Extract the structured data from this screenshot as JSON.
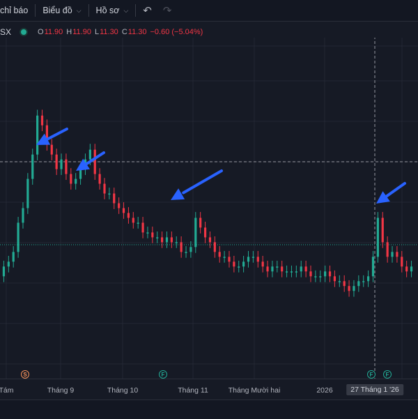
{
  "toolbar": {
    "indicators_label": "chỉ báo",
    "chart_label": "Biểu đồ",
    "profile_label": "Hồ sơ",
    "undo_icon": "undo-icon",
    "redo_icon": "redo-icon"
  },
  "legend": {
    "symbol": "SX",
    "open_label": "O",
    "open": "11.90",
    "high_label": "H",
    "high": "11.90",
    "low_label": "L",
    "low": "11.30",
    "close_label": "C",
    "close": "11.30",
    "change": "−0.60 (−5.04%)"
  },
  "colors": {
    "up": "#22ab94",
    "down": "#f23645",
    "annotation": "#2962ff",
    "background": "#161a25"
  },
  "events": [
    {
      "letter": "S"
    },
    {
      "letter": "F"
    },
    {
      "letter": "F"
    },
    {
      "letter": "F"
    }
  ],
  "x_axis": {
    "labels": [
      "Tám",
      "Tháng 9",
      "Tháng 10",
      "Tháng 11",
      "Tháng Mười hai",
      "2026"
    ],
    "crosshair_label": "27 Tháng 1 '26"
  },
  "chart_data": {
    "type": "candlestick",
    "x_start": "Aug 2025",
    "x_end": "Feb 2026",
    "y_levels": {
      "dashed_reference": 1,
      "dotted_last_price": 1
    },
    "close_values": [
      11.3,
      11.4,
      11.6,
      12.2,
      12.5,
      13.1,
      13.6,
      14.4,
      14.2,
      13.8,
      13.6,
      13.3,
      13.5,
      13.2,
      13.0,
      13.1,
      13.3,
      13.5,
      13.7,
      13.2,
      13.0,
      12.8,
      12.8,
      12.6,
      12.5,
      12.4,
      12.3,
      12.2,
      12.2,
      12.0,
      12.0,
      11.9,
      11.9,
      11.8,
      11.9,
      11.8,
      11.8,
      11.6,
      11.6,
      11.7,
      12.3,
      12.1,
      11.9,
      11.8,
      11.6,
      11.5,
      11.5,
      11.4,
      11.3,
      11.3,
      11.4,
      11.5,
      11.5,
      11.4,
      11.3,
      11.2,
      11.3,
      11.3,
      11.2,
      11.2,
      11.2,
      11.2,
      11.3,
      11.2,
      11.1,
      11.1,
      11.1,
      11.2,
      11.1,
      11.0,
      11.0,
      10.9,
      10.8,
      10.9,
      11.0,
      11.0,
      11.1,
      11.5,
      12.3,
      11.8,
      11.5,
      11.6,
      11.5,
      11.3,
      11.2,
      11.3
    ]
  },
  "annotations": {
    "arrow_count": 4
  }
}
